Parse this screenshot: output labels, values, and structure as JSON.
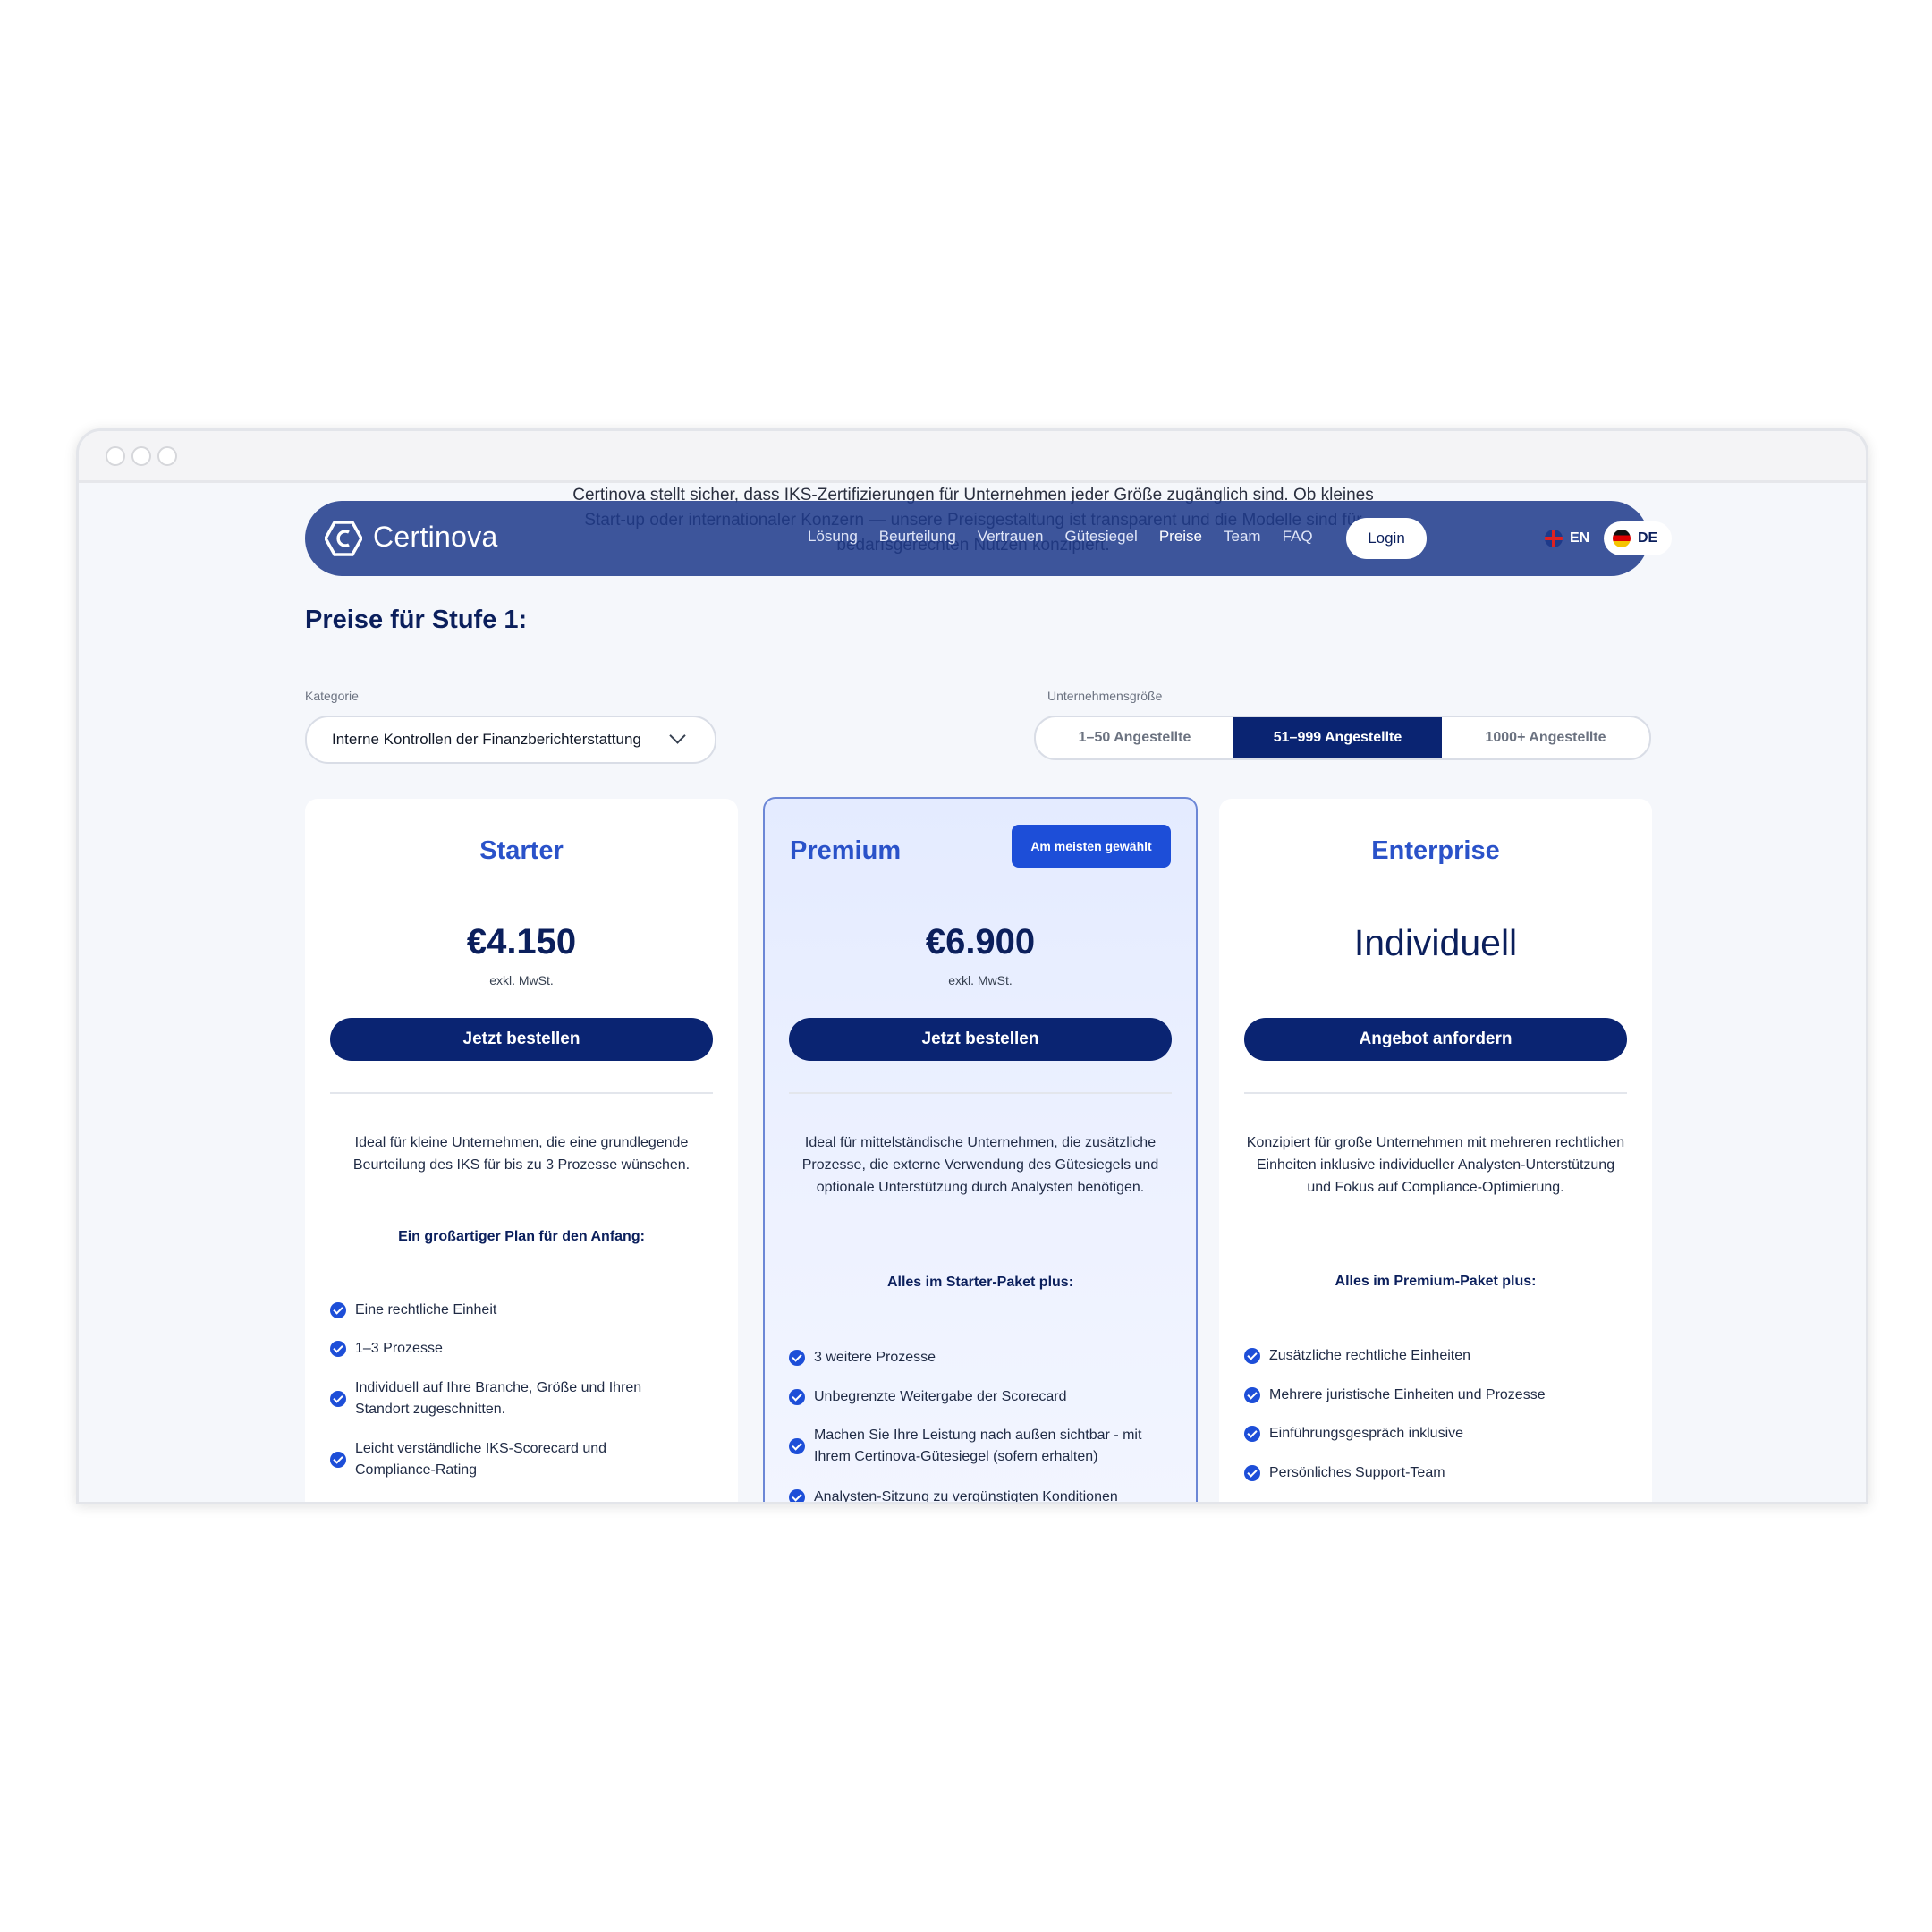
{
  "background_text": "Certinova stellt sicher, dass IKS-Zertifizierungen für Unternehmen jeder Größe zugänglich sind. Ob kleines Start-up oder internationaler Konzern — unsere Preisgestaltung ist transparent und die Modelle sind für bedarfsgerechten Nutzen konzipiert.",
  "nav": {
    "brand": "Certinova",
    "links": [
      "Lösung",
      "Beurteilung",
      "Vertrauen",
      "Gütesiegel",
      "Preise",
      "Team",
      "FAQ"
    ],
    "active_link": "Preise",
    "login": "Login",
    "lang_en": "EN",
    "lang_de": "DE"
  },
  "page": {
    "title": "Preise für Stufe 1:",
    "category_label": "Kategorie",
    "category_value": "Interne Kontrollen der Finanzberichterstattung",
    "size_label": "Unternehmensgröße",
    "sizes": [
      "1–50 Angestellte",
      "51–999 Angestellte",
      "1000+ Angestellte"
    ],
    "selected_size": "51–999 Angestellte"
  },
  "plans": [
    {
      "name": "Starter",
      "price": "€4.150",
      "vat": "exkl. MwSt.",
      "cta": "Jetzt bestellen",
      "description": "Ideal für kleine Unternehmen, die eine grundlegende Beurteilung des IKS für bis zu 3 Prozesse wünschen.",
      "features_heading": "Ein großartiger Plan für den Anfang:",
      "features": [
        "Eine rechtliche Einheit",
        "1–3 Prozesse",
        "Individuell auf Ihre Branche, Größe und Ihren Standort zugeschnitten.",
        "Leicht verständliche IKS-Scorecard und Compliance-Rating"
      ]
    },
    {
      "name": "Premium",
      "badge": "Am meisten gewählt",
      "price": "€6.900",
      "vat": "exkl. MwSt.",
      "cta": "Jetzt bestellen",
      "description": "Ideal für mittelständische Unternehmen, die zusätzliche Prozesse, die externe Verwendung des Gütesiegels und optionale Unterstützung durch Analysten benötigen.",
      "features_heading": "Alles im Starter-Paket plus:",
      "features": [
        "3 weitere Prozesse",
        "Unbegrenzte Weitergabe der Scorecard",
        "Machen Sie Ihre Leistung nach außen sichtbar - mit Ihrem Certinova-Gütesiegel (sofern erhalten)",
        "Analysten-Sitzung zu vergünstigten Konditionen"
      ]
    },
    {
      "name": "Enterprise",
      "price": "Individuell",
      "cta": "Angebot anfordern",
      "description": "Konzipiert für große Unternehmen mit mehreren rechtlichen Einheiten inklusive individueller Analysten-Unterstützung und Fokus auf Compliance-Optimierung.",
      "features_heading": "Alles im Premium-Paket plus:",
      "features": [
        "Zusätzliche rechtliche Einheiten",
        "Mehrere juristische Einheiten und Prozesse",
        "Einführungsgespräch inklusive",
        "Persönliches Support-Team"
      ]
    }
  ],
  "colors": {
    "navy": "#0a2472",
    "accent": "#1d4ed8",
    "nav_bg": "#1e3a8a",
    "page_bg": "#f5f7fb"
  }
}
